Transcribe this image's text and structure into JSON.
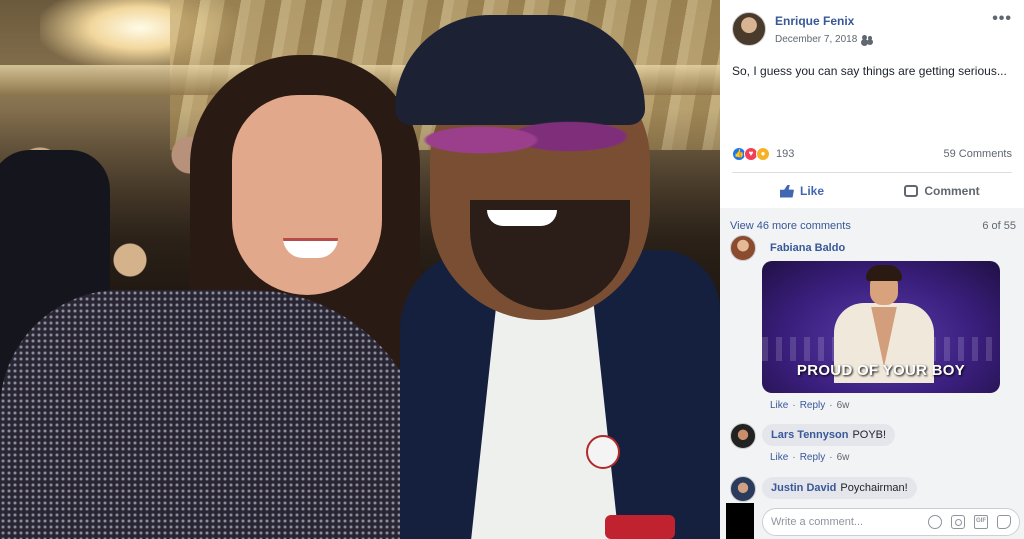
{
  "post": {
    "author": "Enrique Fenix",
    "date": "December 7, 2018",
    "privacy_icon": "friends-icon",
    "more_label": "•••",
    "text": "So, I guess you can say things are getting serious..."
  },
  "reactions": {
    "icons": [
      "like-icon",
      "love-icon",
      "wow-icon"
    ],
    "count": "193",
    "comments_count": "59 Comments"
  },
  "actions": {
    "like_label": "Like",
    "comment_label": "Comment"
  },
  "comments_section": {
    "view_more": "View 46 more comments",
    "pager": "6 of 55",
    "comments": [
      {
        "name": "Fabiana Baldo",
        "text": "",
        "gif_caption": "PROUD OF YOUR BOY",
        "like": "Like",
        "reply": "Reply",
        "time": "6w"
      },
      {
        "name": "Lars Tennyson",
        "text": "POYB!",
        "like": "Like",
        "reply": "Reply",
        "time": "6w"
      },
      {
        "name": "Justin David",
        "text": "Poychairman!"
      }
    ],
    "composer_placeholder": "Write a comment...",
    "composer_icons": [
      "emoji-icon",
      "camera-icon",
      "gif-icon",
      "sticker-icon"
    ]
  },
  "colors": {
    "link_blue": "#385898",
    "like_blue": "#4267b2",
    "bubble_gray": "#e4e6eb",
    "panel_bg": "#f2f3f5"
  }
}
